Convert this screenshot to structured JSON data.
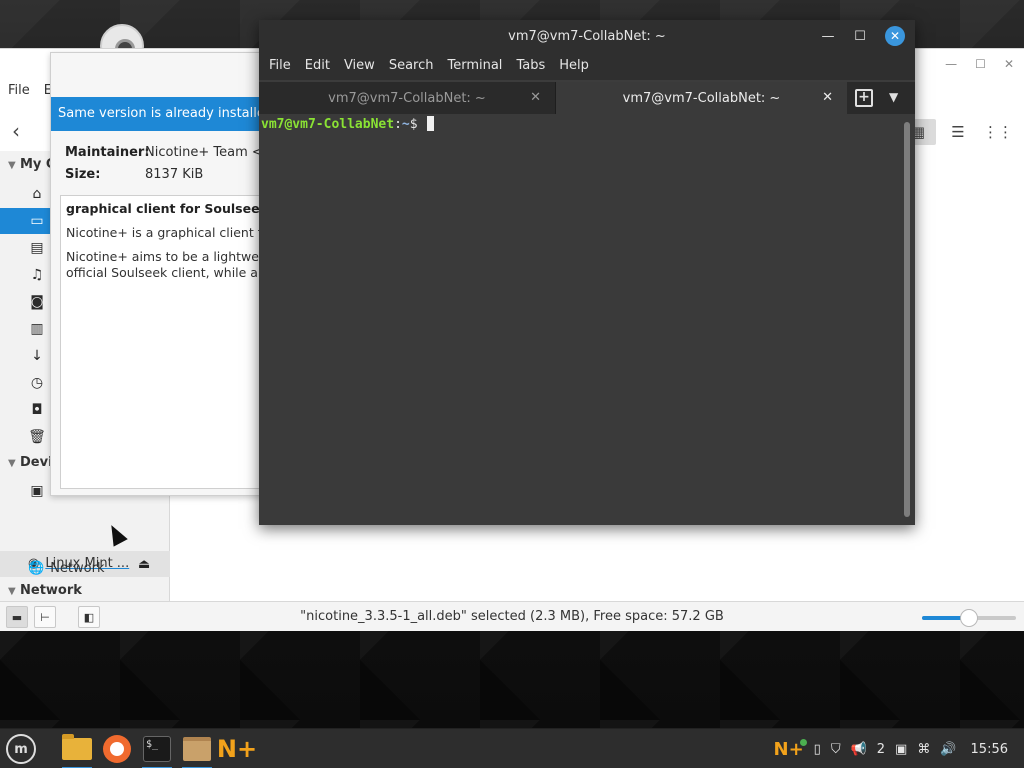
{
  "file_manager": {
    "menu": [
      "File",
      "E"
    ],
    "sidebar": {
      "section_my": "My C",
      "section_devices": "Devi",
      "device_label": "Linux Mint ...",
      "section_network": "Network",
      "network_item": "Network"
    },
    "status_text": "\"nicotine_3.3.5-1_all.deb\" selected (2.3 MB), Free space: 57.2 GB",
    "zoom_level": 0.5
  },
  "package_installer": {
    "banner": "Same version is already installed",
    "maintainer_label": "Maintainer:",
    "maintainer_value": "Nicotine+ Team <ni",
    "size_label": "Size:",
    "size_value": "8137 KiB",
    "desc_title": "graphical client for Soulseek pe",
    "desc_line1": "Nicotine+ is a graphical client for",
    "desc_line2": "Nicotine+ aims to be a lightweigh",
    "desc_line3": "official Soulseek client, while als"
  },
  "terminal": {
    "title": "vm7@vm7-CollabNet: ~",
    "menu": [
      "File",
      "Edit",
      "View",
      "Search",
      "Terminal",
      "Tabs",
      "Help"
    ],
    "tabs": [
      {
        "label": "vm7@vm7-CollabNet: ~",
        "active": false
      },
      {
        "label": "vm7@vm7-CollabNet: ~",
        "active": true
      }
    ],
    "prompt_user": "vm7@vm7-CollabNet",
    "prompt_sep": ":",
    "prompt_path": "~",
    "prompt_symbol": "$"
  },
  "taskbar": {
    "tray_count": "2",
    "clock": "15:56"
  },
  "colors": {
    "accent": "#1e88d6",
    "terminal_bg": "#3a3a3a",
    "prompt_green": "#8ae234"
  }
}
